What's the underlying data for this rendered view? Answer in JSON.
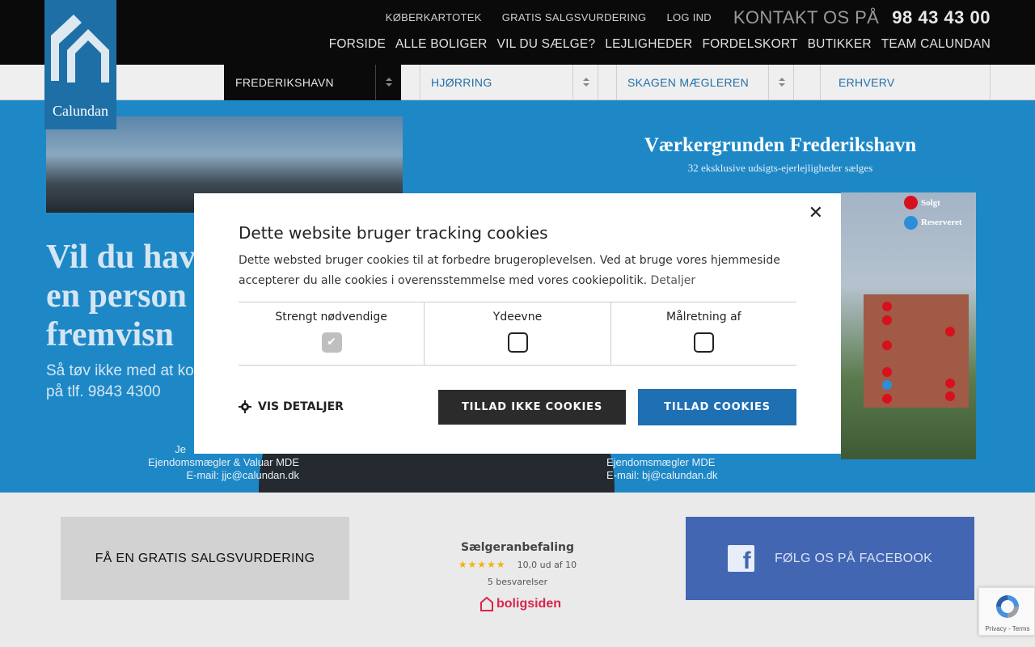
{
  "brand": {
    "name": "Calundan",
    "accent": "#1f6fa7"
  },
  "header": {
    "util_nav": [
      "KØBERKARTOTEK",
      "GRATIS SALGSVURDERING",
      "LOG IND"
    ],
    "contact_label": "KONTAKT OS PÅ",
    "contact_phone": "98 43 43 00",
    "main_nav": [
      "FORSIDE",
      "ALLE BOLIGER",
      "VIL DU SÆLGE?",
      "LEJLIGHEDER",
      "FORDELSKORT",
      "BUTIKKER",
      "TEAM CALUNDAN"
    ]
  },
  "selectors": [
    {
      "label": "FREDERIKSHAVN",
      "active": true
    },
    {
      "label": "HJØRRING",
      "active": false
    },
    {
      "label": "SKAGEN MÆGLEREN",
      "active": false
    },
    {
      "label": "ERHVERV",
      "active": false
    }
  ],
  "hero": {
    "title_lines": [
      "Vil du hav",
      "en person",
      "fremvisn"
    ],
    "sub_lines": [
      "Så tøv ikke med at kon",
      "på tlf. 9843 4300"
    ],
    "agent1": [
      "Je",
      "Ejendomsmægler & Valuar MDE",
      "E-mail: jjc@calundan.dk"
    ],
    "agent2": [
      "Ejendomsmægler MDE",
      "E-mail: bj@calundan.dk"
    ],
    "project_title": "Værkergrunden Frederikshavn",
    "project_sub": "32 eksklusive udsigts-ejerlejligheder sælges",
    "legend": [
      {
        "label": "Solgt",
        "color": "#d8101e"
      },
      {
        "label": "Reserveret",
        "color": "#2a8fd6"
      }
    ]
  },
  "cookie_modal": {
    "title": "Dette website bruger tracking cookies",
    "text": "Dette websted bruger cookies til at forbedre brugeroplevelsen. Ved at bruge vores hjemmeside accepterer du alle cookies i overensstemmelse med vores cookiepolitik.",
    "details_link": "Detaljer",
    "categories": [
      {
        "label": "Strengt nødvendige",
        "checked": true
      },
      {
        "label": "Ydeevne",
        "checked": false
      },
      {
        "label": "Målretning af",
        "checked": false
      }
    ],
    "show_details": "VIS DETALJER",
    "deny_button": "TILLAD IKKE COOKIES",
    "allow_button": "TILLAD COOKIES",
    "close_icon": "close-icon"
  },
  "bottom": {
    "sale_cta": "FÅ EN GRATIS SALGSVURDERING",
    "rating_title": "Sælgeranbefaling",
    "rating_score": "10,0 ud af 10",
    "rating_count": "5 besvarelser",
    "rating_stars": 5,
    "rating_source": "boligsiden",
    "facebook_cta": "FØLG OS PÅ FACEBOOK"
  },
  "recaptcha": {
    "text": "Privacy - Terms"
  }
}
